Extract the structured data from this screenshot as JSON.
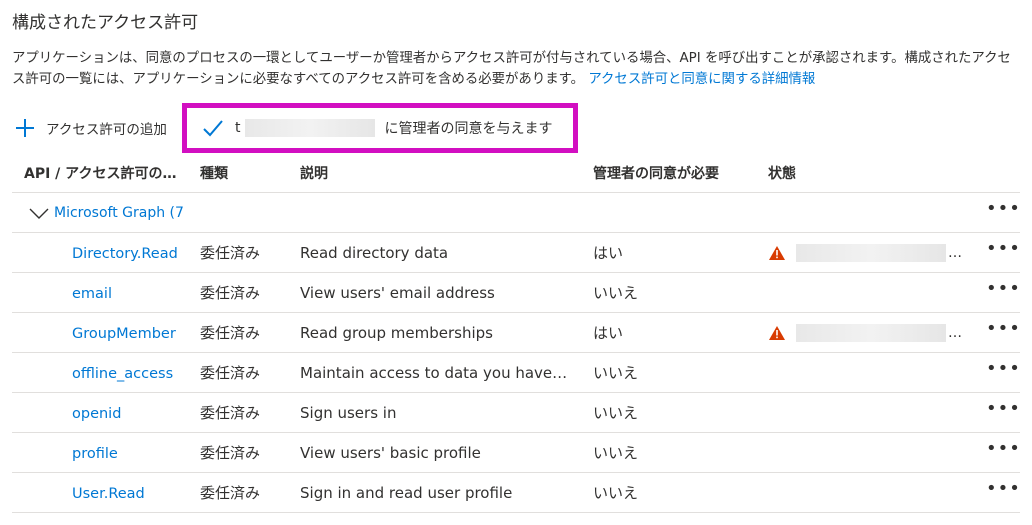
{
  "page": {
    "title": "構成されたアクセス許可",
    "description": "アプリケーションは、同意のプロセスの一環としてユーザーか管理者からアクセス許可が付与されている場合、API を呼び出すことが承認されます。構成されたアクセス許可の一覧には、アプリケーションに必要なすべてのアクセス許可を含める必要があります。",
    "learn_more_link": "アクセス許可と同意に関する詳細情報"
  },
  "toolbar": {
    "add_label": "アクセス許可の追加",
    "grant_tenant_initial": "t",
    "grant_label": "に管理者の同意を与えます"
  },
  "table": {
    "headers": {
      "api": "API / アクセス許可の…",
      "type": "種類",
      "description": "説明",
      "admin_consent": "管理者の同意が必要",
      "status": "状態"
    },
    "group": {
      "label": "Microsoft Graph (7"
    },
    "rows": [
      {
        "name": "Directory.Read",
        "type": "委任済み",
        "description": "Read directory data",
        "admin": "はい",
        "warn": true
      },
      {
        "name": "email",
        "type": "委任済み",
        "description": "View users' email address",
        "admin": "いいえ",
        "warn": false
      },
      {
        "name": "GroupMember",
        "type": "委任済み",
        "description": "Read group memberships",
        "admin": "はい",
        "warn": true
      },
      {
        "name": "offline_access",
        "type": "委任済み",
        "description": "Maintain access to data you have…",
        "admin": "いいえ",
        "warn": false
      },
      {
        "name": "openid",
        "type": "委任済み",
        "description": "Sign users in",
        "admin": "いいえ",
        "warn": false
      },
      {
        "name": "profile",
        "type": "委任済み",
        "description": "View users' basic profile",
        "admin": "いいえ",
        "warn": false
      },
      {
        "name": "User.Read",
        "type": "委任済み",
        "description": "Sign in and read user profile",
        "admin": "いいえ",
        "warn": false
      }
    ],
    "state_ellipsis": "…"
  },
  "colors": {
    "accent": "#0078d4",
    "highlight_border": "#d20fc1",
    "warning": "#d83b01"
  }
}
